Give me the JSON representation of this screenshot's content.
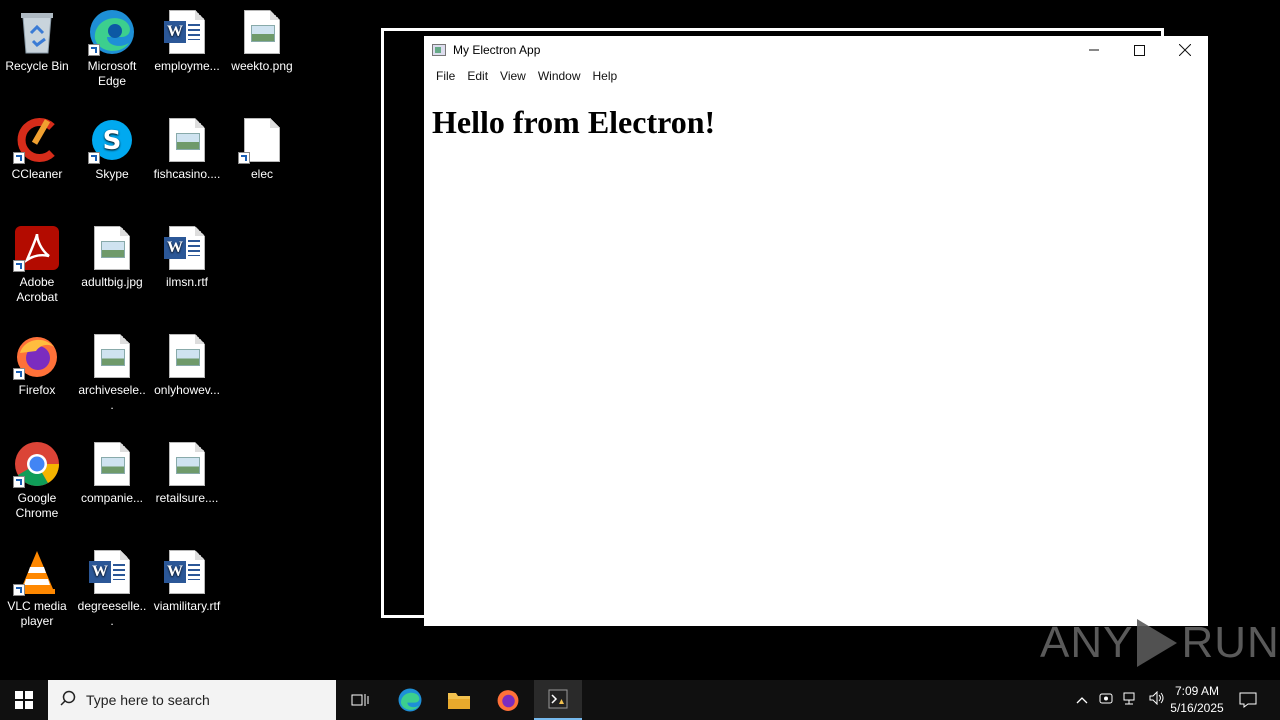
{
  "desktop": {
    "icons": [
      {
        "label": "Recycle Bin",
        "icon": "recycle-bin-icon"
      },
      {
        "label": "Microsoft Edge",
        "icon": "edge-icon"
      },
      {
        "label": "employme...",
        "icon": "word-doc-icon"
      },
      {
        "label": "weekto.png",
        "icon": "image-file-icon"
      },
      {
        "label": "CCleaner",
        "icon": "ccleaner-icon"
      },
      {
        "label": "Skype",
        "icon": "skype-icon"
      },
      {
        "label": "fishcasino....",
        "icon": "image-file-icon"
      },
      {
        "label": "elec",
        "icon": "blank-file-icon"
      },
      {
        "label": "Adobe Acrobat",
        "icon": "acrobat-icon"
      },
      {
        "label": "adultbig.jpg",
        "icon": "image-file-icon"
      },
      {
        "label": "ilmsn.rtf",
        "icon": "word-doc-icon"
      },
      {
        "label": "Firefox",
        "icon": "firefox-icon"
      },
      {
        "label": "archivesele...",
        "icon": "image-file-icon"
      },
      {
        "label": "onlyhowev...",
        "icon": "image-file-icon"
      },
      {
        "label": "Google Chrome",
        "icon": "chrome-icon"
      },
      {
        "label": "companie...",
        "icon": "image-file-icon"
      },
      {
        "label": "retailsure....",
        "icon": "image-file-icon"
      },
      {
        "label": "VLC media player",
        "icon": "vlc-icon"
      },
      {
        "label": "degreeselle...",
        "icon": "word-doc-icon"
      },
      {
        "label": "viamilitary.rtf",
        "icon": "word-doc-icon"
      }
    ]
  },
  "window": {
    "title": "My Electron App",
    "menu": [
      "File",
      "Edit",
      "View",
      "Window",
      "Help"
    ],
    "heading": "Hello from Electron!"
  },
  "watermark": {
    "left": "ANY",
    "right": "RUN"
  },
  "taskbar": {
    "search_placeholder": "Type here to search",
    "time": "7:09 AM",
    "date": "5/16/2025"
  }
}
